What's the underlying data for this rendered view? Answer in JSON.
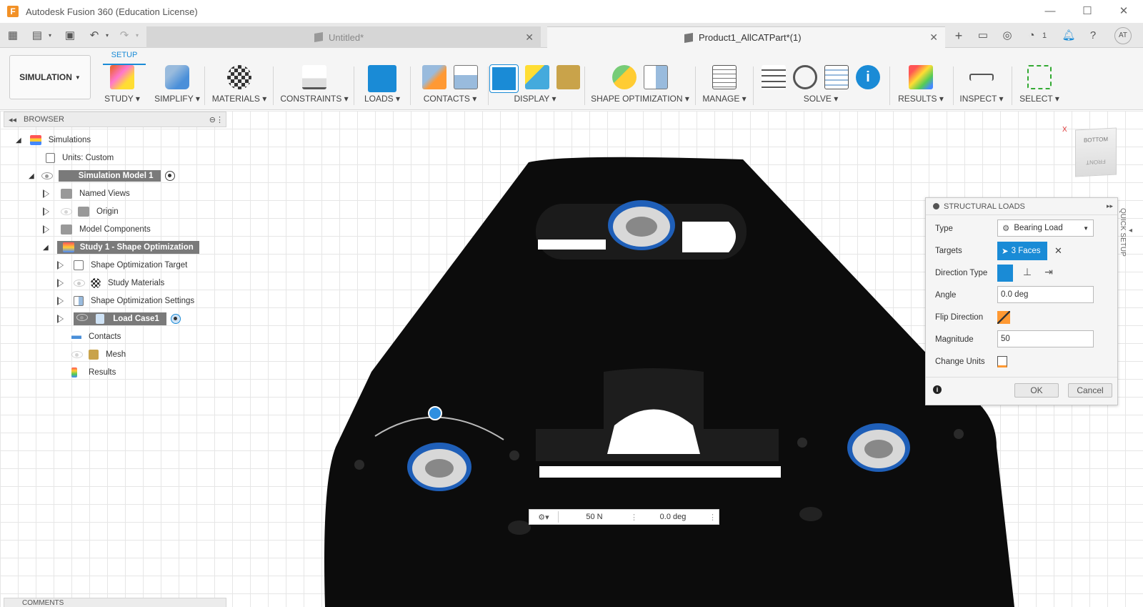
{
  "window": {
    "title": "Autodesk Fusion 360 (Education License)",
    "logo_letter": "F"
  },
  "tabs": [
    {
      "label": "Untitled*",
      "active": false
    },
    {
      "label": "Product1_AllCATPart*(1)",
      "active": true
    }
  ],
  "tabbar_right": {
    "jobs_count": "1",
    "user_initials": "AT"
  },
  "ribbon": {
    "workspace": "SIMULATION",
    "active_tab": "SETUP",
    "groups": [
      "STUDY",
      "SIMPLIFY",
      "MATERIALS",
      "CONSTRAINTS",
      "LOADS",
      "CONTACTS",
      "DISPLAY",
      "SHAPE OPTIMIZATION",
      "MANAGE",
      "SOLVE",
      "RESULTS",
      "INSPECT",
      "SELECT"
    ]
  },
  "browser": {
    "title": "BROWSER",
    "items": [
      {
        "label": "Simulations"
      },
      {
        "label": "Units: Custom"
      },
      {
        "label": "Simulation Model 1"
      },
      {
        "label": "Named Views"
      },
      {
        "label": "Origin"
      },
      {
        "label": "Model Components"
      },
      {
        "label": "Study 1 - Shape Optimization"
      },
      {
        "label": "Shape Optimization Target"
      },
      {
        "label": "Study Materials"
      },
      {
        "label": "Shape Optimization Settings"
      },
      {
        "label": "Load Case1"
      },
      {
        "label": "Contacts"
      },
      {
        "label": "Mesh"
      },
      {
        "label": "Results"
      }
    ]
  },
  "comments": {
    "title": "COMMENTS"
  },
  "dialog": {
    "title": "STRUCTURAL LOADS",
    "type_label": "Type",
    "type_value": "Bearing Load",
    "targets_label": "Targets",
    "targets_value": "3 Faces",
    "direction_type_label": "Direction Type",
    "angle_label": "Angle",
    "angle_value": "0.0 deg",
    "flip_direction_label": "Flip Direction",
    "magnitude_label": "Magnitude",
    "magnitude_value": "50",
    "change_units_label": "Change Units",
    "ok_label": "OK",
    "cancel_label": "Cancel"
  },
  "quick_setup": "QUICK SETUP",
  "viewcube": {
    "top": "BOTTOM",
    "front": "FRONT",
    "axis": "X"
  },
  "hud": {
    "magnitude": "50 N",
    "angle": "0.0 deg"
  },
  "colors": {
    "accent": "#1a8bd6",
    "highlight": "#7a7a7a",
    "model": "#0c0c0c",
    "bearing": "#2f6fd1"
  }
}
